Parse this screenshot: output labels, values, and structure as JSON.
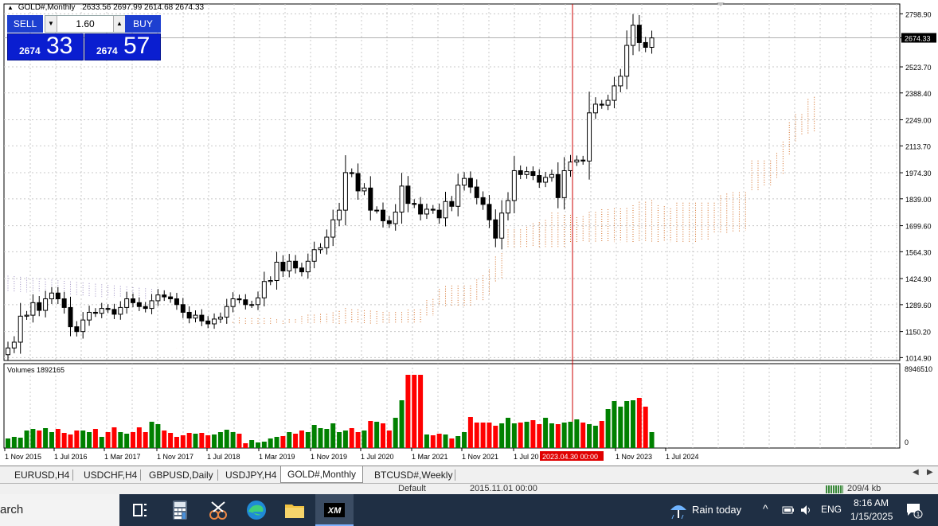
{
  "header": {
    "symbol": "GOLD#,Monthly",
    "ohlc": "2633.56 2697.99 2614.68 2674.33"
  },
  "trade": {
    "sell_label": "SELL",
    "buy_label": "BUY",
    "lot": "1.60",
    "sell_small": "2674",
    "sell_big": "33",
    "buy_small": "2674",
    "buy_big": "57"
  },
  "chart_data": {
    "type": "candlestick",
    "title": "GOLD#,Monthly",
    "ylim": [
      1000,
      2850
    ],
    "y_ticks": [
      "2798.90",
      "2674.33",
      "2523.70",
      "2388.40",
      "2249.00",
      "2113.70",
      "1974.30",
      "1839.00",
      "1699.60",
      "1564.30",
      "1424.90",
      "1289.60",
      "1150.20",
      "1014.90"
    ],
    "current_price": 2674.33,
    "x_tick_labels": [
      "1 Nov 2015",
      "1 Jul 2016",
      "1 Mar 2017",
      "1 Nov 2017",
      "1 Jul 2018",
      "1 Mar 2019",
      "1 Nov 2019",
      "1 Jul 2020",
      "1 Mar 2021",
      "1 Nov 2021",
      "1 Jul 20",
      "1 Nov 2023",
      "1 Jul 2024"
    ],
    "crosshair_label": "2023.04.30 00:00",
    "closes": [
      1065,
      1095,
      1230,
      1235,
      1300,
      1260,
      1320,
      1350,
      1320,
      1275,
      1175,
      1150,
      1210,
      1250,
      1245,
      1270,
      1265,
      1240,
      1275,
      1320,
      1300,
      1280,
      1270,
      1310,
      1340,
      1330,
      1320,
      1290,
      1250,
      1220,
      1235,
      1205,
      1190,
      1215,
      1225,
      1280,
      1320,
      1315,
      1290,
      1290,
      1325,
      1410,
      1415,
      1510,
      1465,
      1515,
      1480,
      1460,
      1515,
      1575,
      1585,
      1640,
      1730,
      1780,
      1975,
      1970,
      1880,
      1895,
      1780,
      1780,
      1725,
      1710,
      1770,
      1905,
      1815,
      1810,
      1760,
      1785,
      1780,
      1740,
      1825,
      1800,
      1910,
      1945,
      1900,
      1845,
      1810,
      1730,
      1635,
      1765,
      1830,
      1985,
      1965,
      1980,
      1960,
      1925,
      1950,
      1965,
      1845,
      1985,
      2030,
      2040,
      2035,
      2285,
      2330,
      2325,
      2350,
      2425,
      2475,
      2635,
      2740,
      2650,
      2625,
      2674
    ],
    "volume": {
      "label": "Volumes",
      "value": "1892165",
      "max_label": "8946510",
      "zero_label": "0",
      "values": [
        12,
        14,
        13,
        22,
        24,
        22,
        25,
        20,
        24,
        19,
        17,
        22,
        22,
        20,
        24,
        14,
        20,
        26,
        20,
        18,
        20,
        26,
        20,
        33,
        30,
        22,
        19,
        14,
        16,
        19,
        18,
        19,
        16,
        17,
        20,
        23,
        20,
        18,
        6,
        10,
        7,
        8,
        12,
        14,
        15,
        20,
        18,
        22,
        20,
        29,
        25,
        24,
        31,
        20,
        22,
        25,
        20,
        22,
        34,
        33,
        31,
        22,
        38,
        60,
        92,
        92,
        92,
        17,
        16,
        18,
        17,
        12,
        15,
        20,
        39,
        32,
        32,
        32,
        28,
        31,
        38,
        31,
        32,
        33,
        35,
        30,
        38,
        31,
        30,
        32,
        33,
        36,
        32,
        30,
        28,
        34,
        49,
        59,
        52,
        59,
        60,
        63,
        52,
        20
      ],
      "colors_up": "#008000",
      "colors_down": "#ff0000"
    },
    "ichimoku_cloud": true,
    "grid": true
  },
  "colors": {
    "bull_candle": "#ffffff",
    "bear_candle": "#000000",
    "crosshair": "#cc0000",
    "cloud_orange": "#d2691e",
    "cloud_violet": "#9a8cc0",
    "panel_blue": "#0a1ed0"
  },
  "tabs": [
    "EURUSD,H4",
    "USDCHF,H4",
    "GBPUSD,Daily",
    "USDJPY,H4",
    "GOLD#,Monthly",
    "BTCUSD#,Weekly"
  ],
  "active_tab": "GOLD#,Monthly",
  "strip": {
    "profile": "Default",
    "date": "2015.11.01 00:00",
    "traffic": "209/4 kb"
  },
  "taskbar": {
    "search_text": "arch",
    "weather": "Rain today",
    "lang": "ENG",
    "time": "8:16 AM",
    "date": "1/15/2025",
    "notif": "1"
  }
}
